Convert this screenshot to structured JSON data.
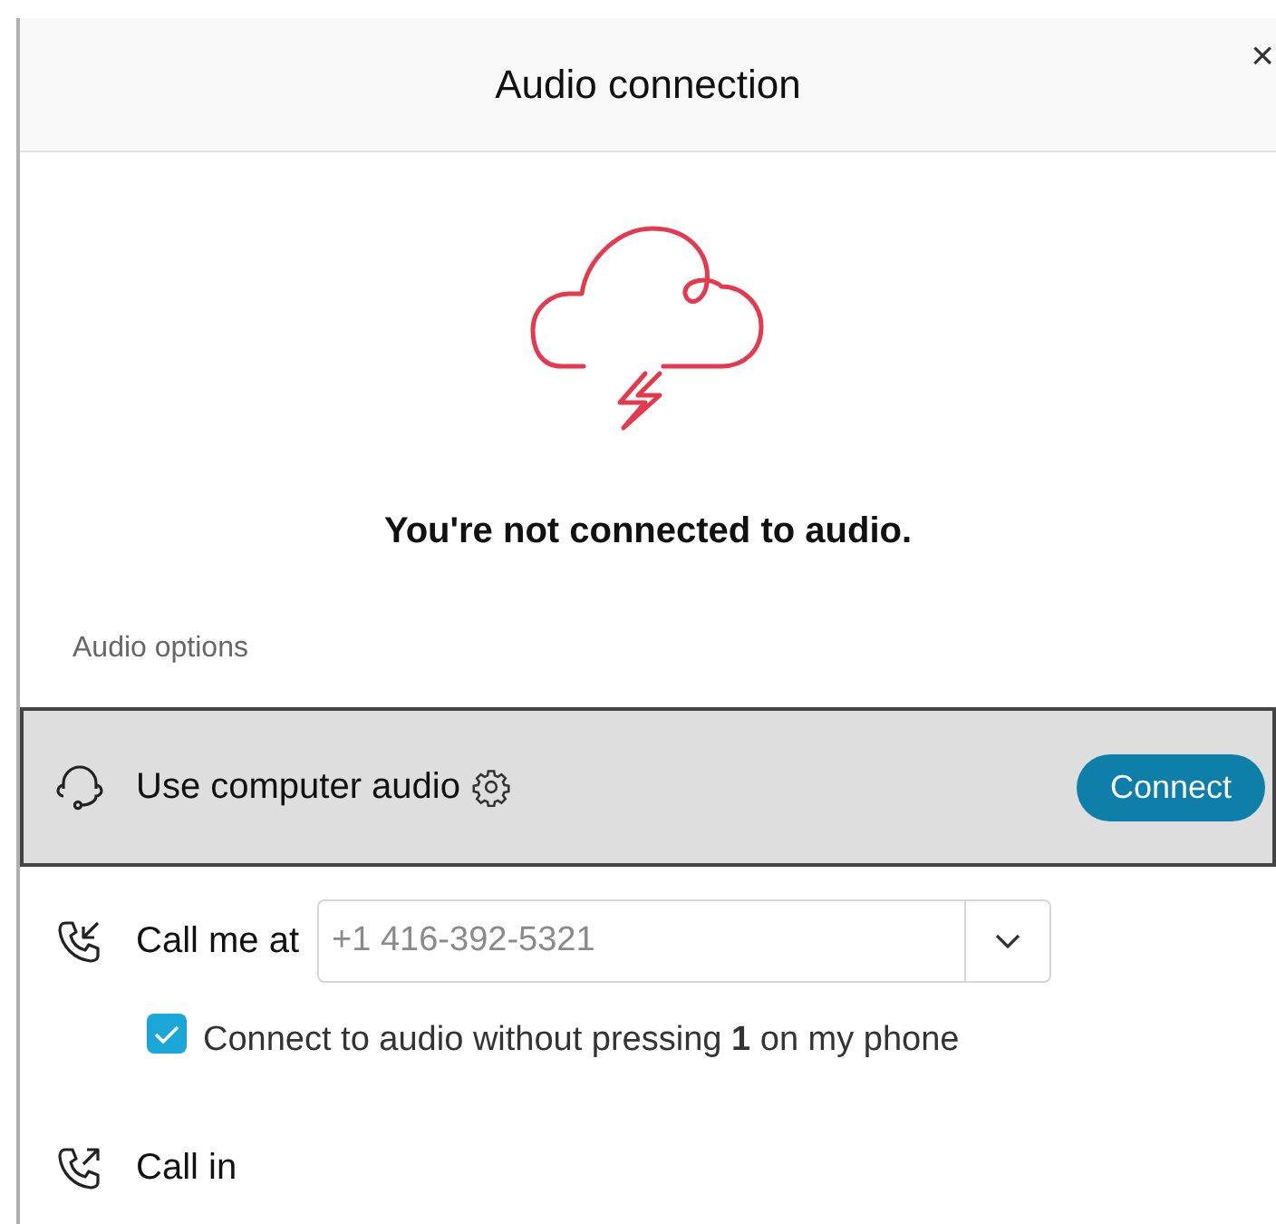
{
  "window": {
    "title": "Audio connection",
    "close": "×"
  },
  "status_message": "You're not connected to audio.",
  "section_label": "Audio options",
  "options": [
    {
      "kind": "computer",
      "label": "Use computer audio",
      "selected": true,
      "button": "Connect"
    },
    {
      "kind": "callme",
      "label": "Call me at",
      "selected": false,
      "phone": {
        "placeholder": "+1 416-392-5321"
      },
      "checkbox": {
        "label": "Connect to audio without pressing **1** on my phone",
        "checked": true
      }
    },
    {
      "kind": "callin",
      "label": "Call in",
      "selected": false
    }
  ]
}
